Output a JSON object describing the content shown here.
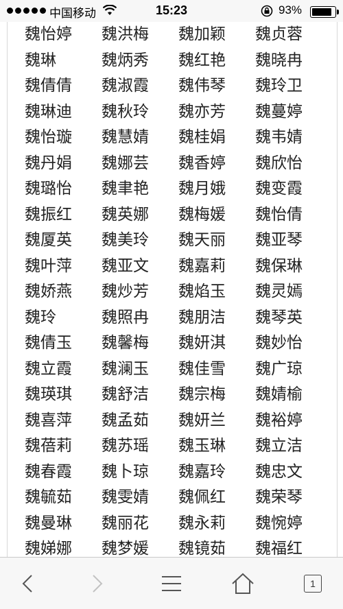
{
  "status_bar": {
    "carrier": "中国移动",
    "time": "15:23",
    "battery_percent": "93%",
    "battery_level": 0.93,
    "signal_bars_filled": 5
  },
  "names": [
    "魏怡婷",
    "魏洪梅",
    "魏加颖",
    "魏贞蓉",
    "魏琳",
    "魏炳秀",
    "魏红艳",
    "魏晓冉",
    "魏倩倩",
    "魏淑霞",
    "魏伟琴",
    "魏玲卫",
    "魏琳迪",
    "魏秋玲",
    "魏亦芳",
    "魏蔓婷",
    "魏怡璇",
    "魏慧婧",
    "魏桂娟",
    "魏韦婧",
    "魏丹娟",
    "魏娜芸",
    "魏香婷",
    "魏欣怡",
    "魏璐怡",
    "魏聿艳",
    "魏月娥",
    "魏变霞",
    "魏振红",
    "魏英娜",
    "魏梅媛",
    "魏怡倩",
    "魏厦英",
    "魏美玲",
    "魏天丽",
    "魏亚琴",
    "魏叶萍",
    "魏亚文",
    "魏嘉莉",
    "魏保琳",
    "魏娇燕",
    "魏炒芳",
    "魏焰玉",
    "魏灵嫣",
    "魏玲",
    "魏照冉",
    "魏朋洁",
    "魏琴英",
    "魏倩玉",
    "魏馨梅",
    "魏妍淇",
    "魏妙怡",
    "魏立霞",
    "魏澜玉",
    "魏佳雪",
    "魏广琼",
    "魏瑛琪",
    "魏舒洁",
    "魏宗梅",
    "魏婧榆",
    "魏喜萍",
    "魏孟茹",
    "魏妍兰",
    "魏裕婷",
    "魏蓓莉",
    "魏苏瑶",
    "魏玉琳",
    "魏立洁",
    "魏春霞",
    "魏卜琼",
    "魏嘉玲",
    "魏忠文",
    "魏毓茹",
    "魏雯婧",
    "魏佩红",
    "魏荣琴",
    "魏曼琳",
    "魏丽花",
    "魏永莉",
    "魏惋婷",
    "魏娣娜",
    "魏梦媛",
    "魏镜茹",
    "魏福红"
  ],
  "toolbar": {
    "tab_count": "1",
    "icons": [
      "back-icon",
      "forward-icon",
      "menu-icon",
      "home-icon",
      "tabs-icon"
    ]
  }
}
